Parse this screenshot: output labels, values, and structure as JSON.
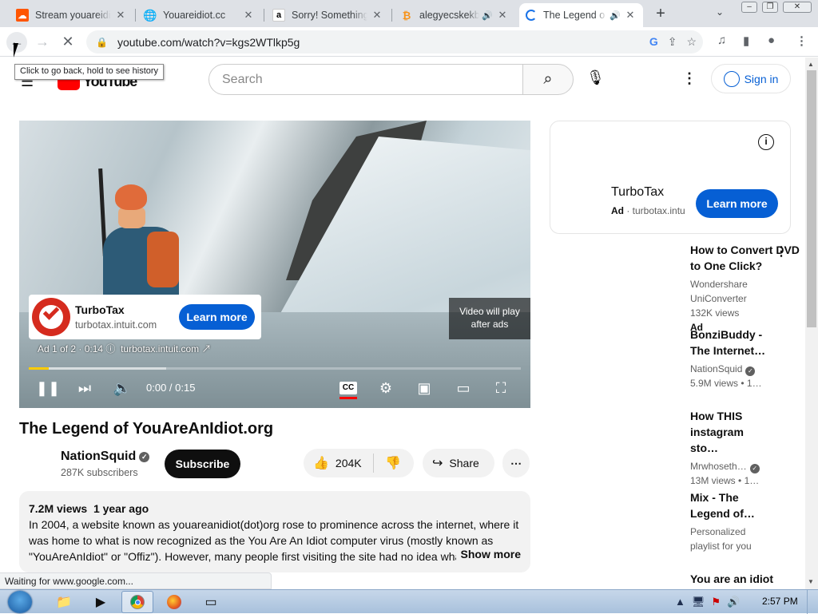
{
  "browser": {
    "tabs": [
      {
        "title": "Stream youareidiot",
        "favicon": "soundcloud-icon",
        "color": "#ff5500"
      },
      {
        "title": "Youareidiot.cc",
        "favicon": "globe-icon",
        "color": "#5f6368"
      },
      {
        "title": "Sorry! Something",
        "favicon": "amazon-icon",
        "color": "#000000"
      },
      {
        "title": "alegyecskekbt",
        "favicon": "bitcoin-icon",
        "color": "#f7931a"
      },
      {
        "title": "The Legend o",
        "favicon": "loading-spinner-icon",
        "color": "#1a73e8"
      }
    ],
    "url": "youtube.com/watch?v=kgs2WTlkp5g",
    "tooltip": "Click to go back, hold to see history",
    "status": "Waiting for www.google.com..."
  },
  "youtube": {
    "logo_text": "YouTube",
    "search_placeholder": "Search",
    "signin_label": "Sign in",
    "player": {
      "ad_card": {
        "name": "TurboTax",
        "domain": "turbotax.intuit.com",
        "cta": "Learn more"
      },
      "video_will_play": "Video will play after ads",
      "ad_info": "Ad 1 of 2 · 0:14",
      "ad_domain": "turbotax.intuit.com",
      "time": "0:00 / 0:15",
      "cc_label": "CC",
      "progress_fraction": 0.04,
      "buffered_fraction": 0.28
    },
    "video": {
      "title": "The Legend of YouAreAnIdiot.org",
      "channel": "NationSquid",
      "subscribers": "287K subscribers",
      "subscribe_label": "Subscribe",
      "likes": "204K",
      "share_label": "Share",
      "views": "7.2M views",
      "age": "1 year ago",
      "description": "In 2004, a website known as youareanidiot(dot)org rose to prominence across the internet, where it was home to what is now recognized as the You Are An Idiot computer virus (mostly known as \"YouAreAnIdiot\" or \"Offiz\"). However, many people first visiting the site had no idea what",
      "show_more": "Show more"
    },
    "side_ad": {
      "name": "TurboTax",
      "ad_label": "Ad",
      "domain": "turbotax.intu",
      "cta": "Learn more"
    },
    "recommendations": [
      {
        "title": "How to Convert DVD to One Click?",
        "channel": "Wondershare UniConverter",
        "views": "132K views",
        "extra": "Ad"
      },
      {
        "title": "BonziBuddy - The Internet…",
        "channel": "NationSquid",
        "views": "5.9M views",
        "age": "1…"
      },
      {
        "title": "How THIS instagram sto…",
        "channel": "Mrwhoseth…",
        "views": "13M views",
        "age": "1…"
      },
      {
        "title": "Mix - The Legend of…",
        "channel": "Personalized playlist for you"
      },
      {
        "title": "You are an idiot"
      }
    ]
  },
  "taskbar": {
    "time": "2:57 PM",
    "apps": [
      "explorer-icon",
      "media-player-icon",
      "chrome-icon",
      "firefox-icon",
      "window-icon"
    ]
  }
}
